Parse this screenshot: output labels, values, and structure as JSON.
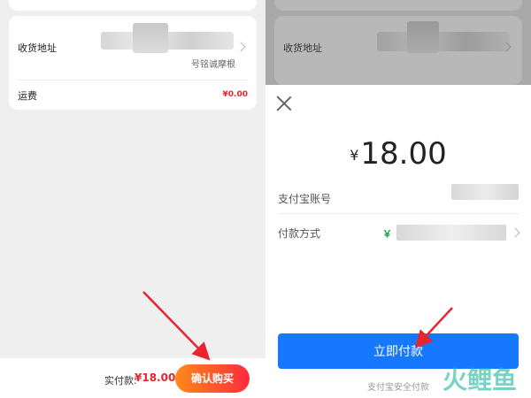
{
  "left": {
    "address_label": "收货地址",
    "address_sub": "号铭诚摩根",
    "shipping_label": "运费",
    "shipping_value": "¥0.00",
    "pay_label": "实付款:",
    "pay_value": "¥18.00",
    "confirm_label": "确认购买"
  },
  "right": {
    "address_label": "收货地址",
    "amount_currency": "¥",
    "amount_value": "18.00",
    "account_label": "支付宝账号",
    "method_label": "付款方式",
    "method_icon": "bank-icon",
    "pay_now_label": "立即付款",
    "footer_text": "支付宝安全付款"
  },
  "watermark": "火鲤鱼",
  "colors": {
    "accent_red": "#e8242e",
    "button_gradient_start": "#ff8a1a",
    "button_gradient_end": "#ff2a3d",
    "alipay_blue": "#1677ff",
    "annotation_arrow": "#e8242e"
  }
}
